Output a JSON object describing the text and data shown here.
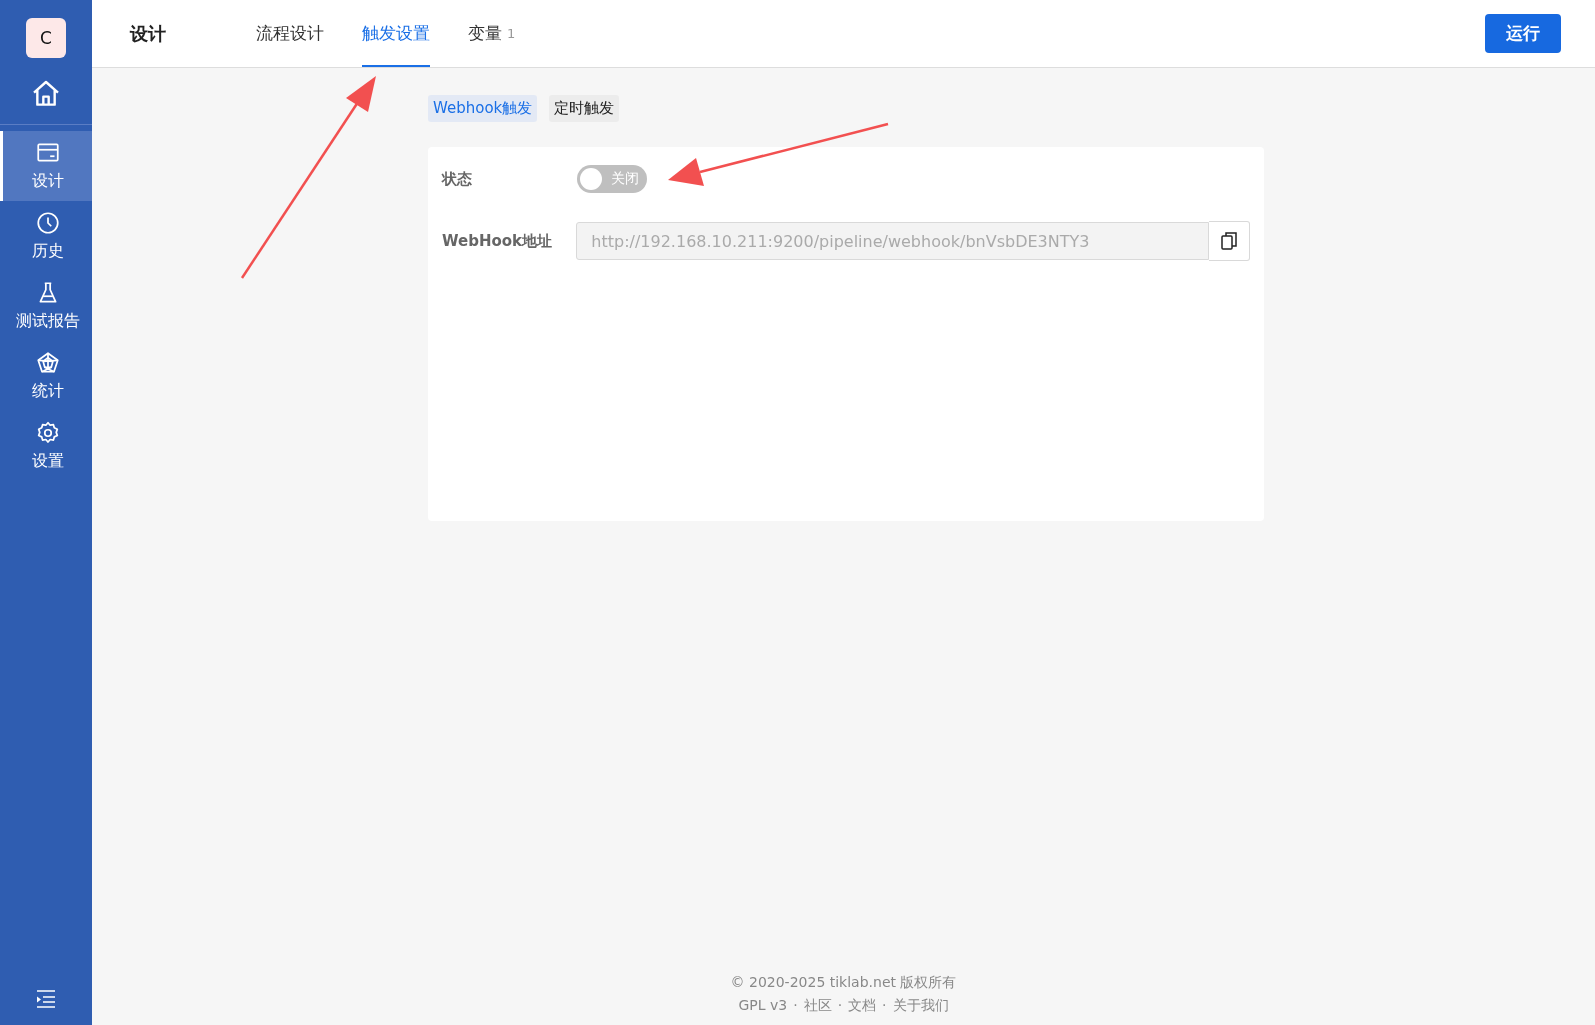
{
  "sidebar": {
    "logo": "C",
    "items": [
      {
        "kind": "design",
        "label": "设计",
        "selected": true
      },
      {
        "kind": "history",
        "label": "历史",
        "selected": false
      },
      {
        "kind": "test",
        "label": "测试报告",
        "selected": false
      },
      {
        "kind": "stats",
        "label": "统计",
        "selected": false
      },
      {
        "kind": "settings",
        "label": "设置",
        "selected": false
      }
    ]
  },
  "header": {
    "title": "设计",
    "tabs": [
      {
        "label": "流程设计",
        "selected": false
      },
      {
        "label": "触发设置",
        "selected": true
      },
      {
        "label": "变量",
        "count": "1",
        "selected": false
      }
    ],
    "run_button": "运行"
  },
  "trigger_tabs": [
    {
      "label": "Webhook触发",
      "selected": true
    },
    {
      "label": "定时触发",
      "selected": false
    }
  ],
  "form": {
    "status": {
      "label": "状态",
      "on": false,
      "text": "关闭"
    },
    "webhook": {
      "label": "WebHook地址",
      "value": "http://192.168.10.211:9200/pipeline/webhook/bnVsbDE3NTY3"
    }
  },
  "footer": {
    "copyright": "© 2020-2025 tiklab.net 版权所有",
    "separator": "·",
    "links": [
      "GPL v3",
      "社区",
      "文档",
      "关于我们"
    ]
  }
}
